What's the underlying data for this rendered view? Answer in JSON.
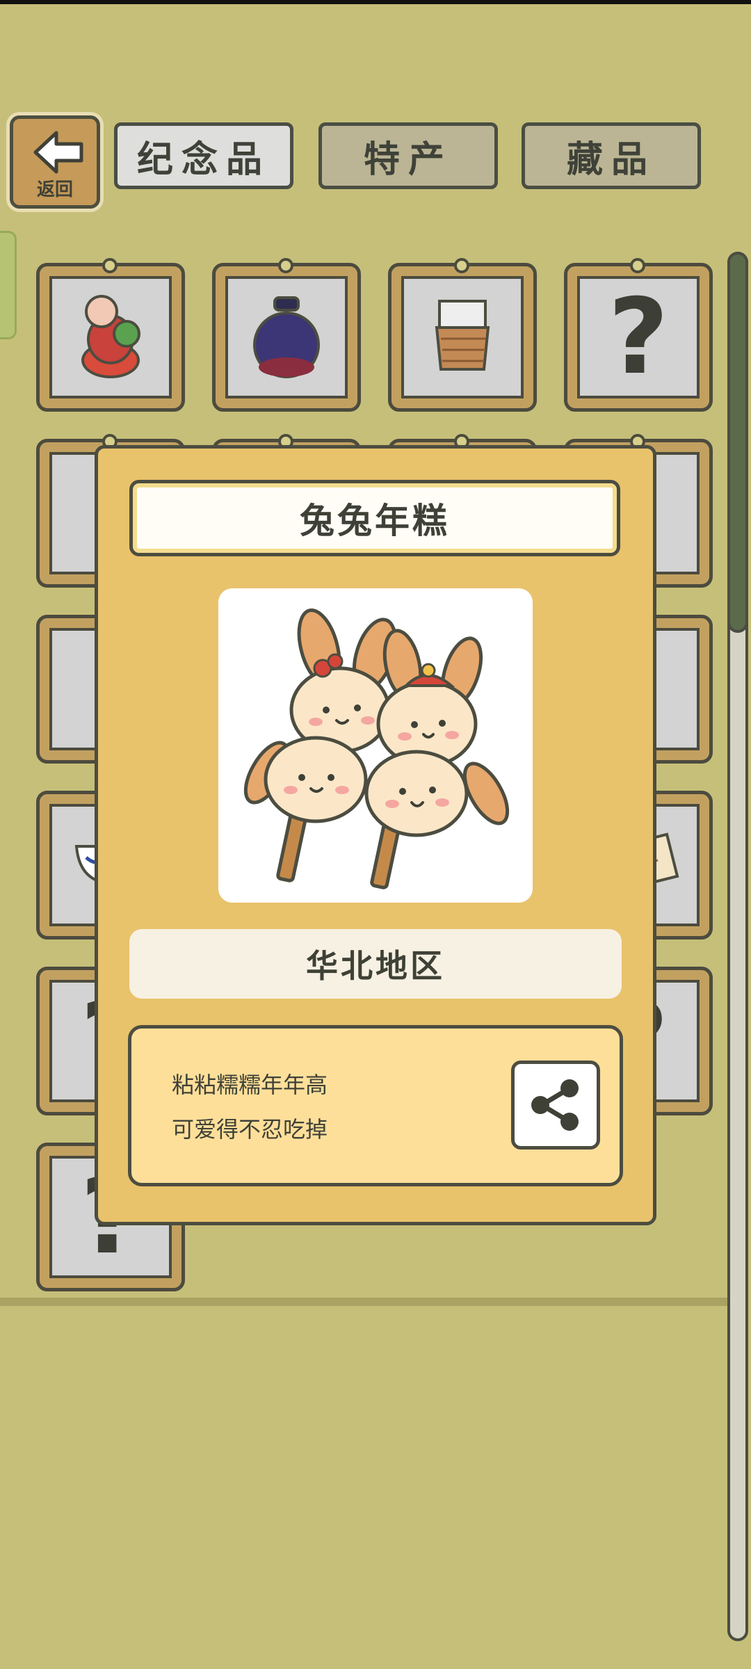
{
  "header": {
    "back_label": "返回",
    "tabs": [
      {
        "label": "纪念品",
        "active": true
      },
      {
        "label": "特产",
        "active": false
      },
      {
        "label": "藏品",
        "active": false
      }
    ]
  },
  "grid": {
    "unknown_mark": "?",
    "slots": [
      {
        "item": "clay-doll-icon"
      },
      {
        "item": "clay-jar-icon"
      },
      {
        "item": "woven-cup-icon"
      },
      {
        "item": "unknown"
      },
      {
        "item": "partially-hidden"
      },
      {
        "item": "partially-hidden"
      },
      {
        "item": "partially-hidden"
      },
      {
        "item": "partially-hidden"
      },
      {
        "item": "partially-hidden"
      },
      {
        "item": "partially-hidden"
      },
      {
        "item": "partially-hidden"
      },
      {
        "item": "partially-hidden"
      },
      {
        "item": "blue-white-bowl-icon"
      },
      {
        "item": "unknown"
      },
      {
        "item": "unknown"
      },
      {
        "item": "scroll-icon"
      },
      {
        "item": "unknown"
      },
      {
        "item": "paper-cut-icon"
      },
      {
        "item": "rabbit-cake-icon"
      },
      {
        "item": "unknown"
      },
      {
        "item": "unknown"
      }
    ]
  },
  "modal": {
    "title": "兔兔年糕",
    "image_icon": "rabbit-rice-cake-icon",
    "region": "华北地区",
    "description_lines": [
      "粘粘糯糯年年高",
      "可爱得不忍吃掉"
    ],
    "share_icon": "share-icon"
  },
  "colors": {
    "background": "#c6bf79",
    "modal": "#e9c26c",
    "outline": "#4c4d40",
    "frame": "#c2a160"
  }
}
